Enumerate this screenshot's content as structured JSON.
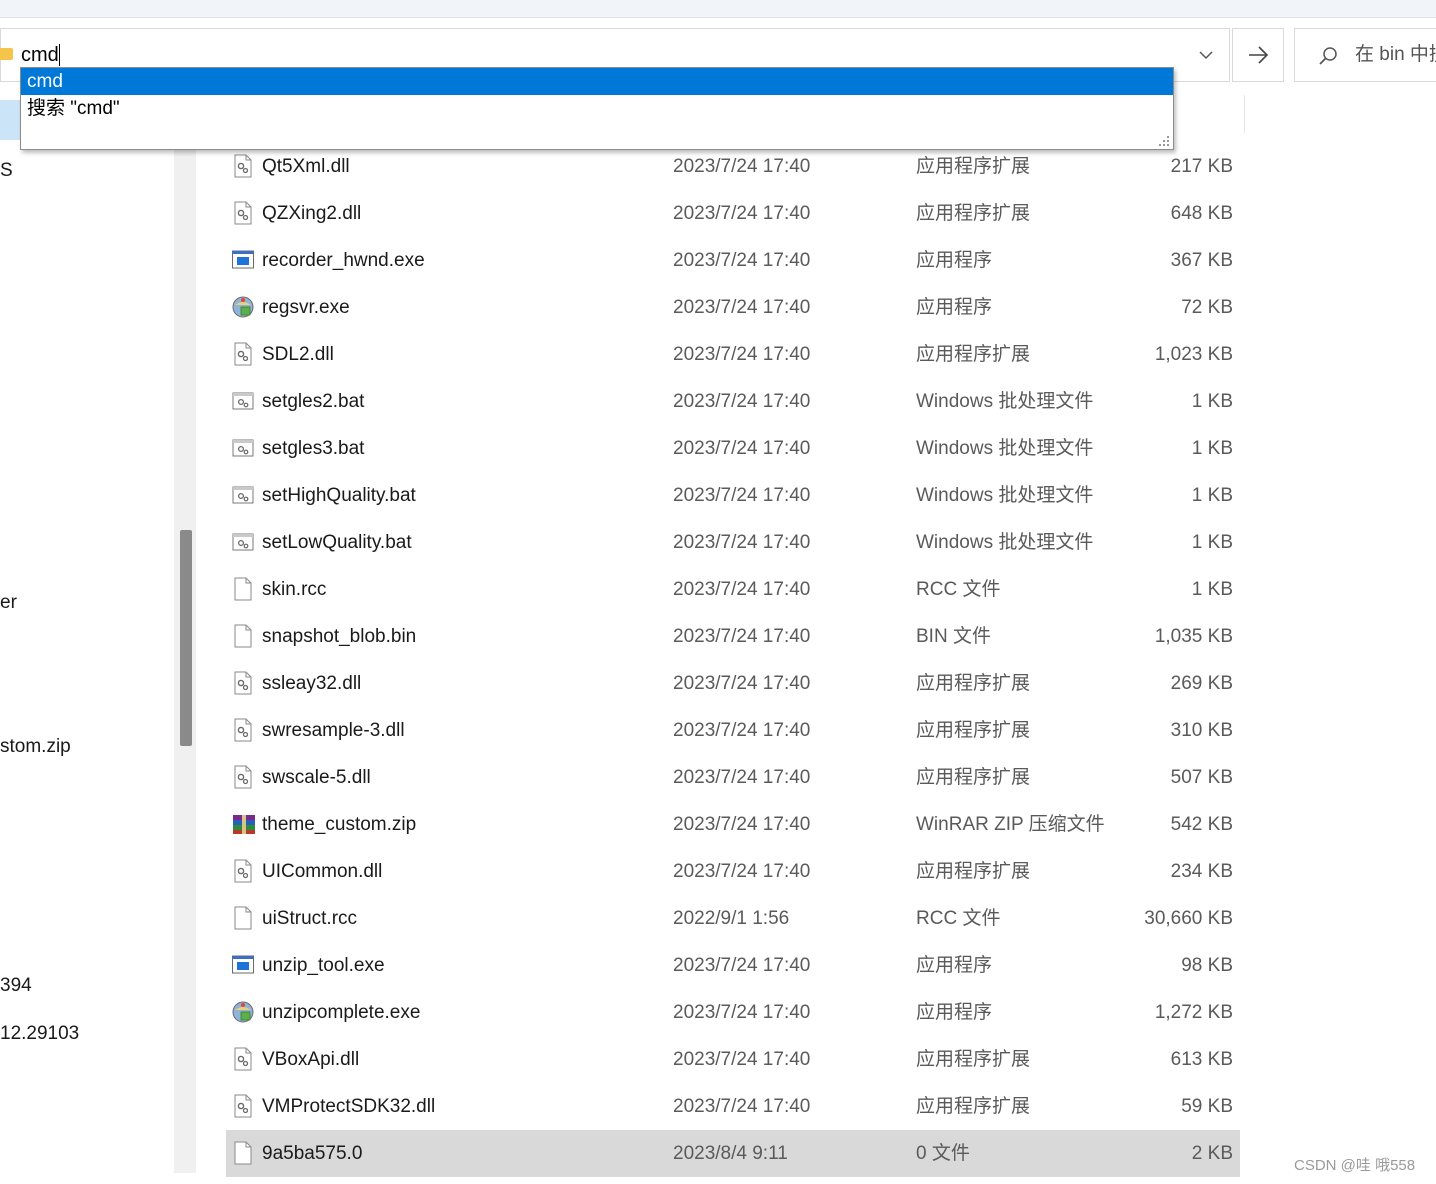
{
  "address_bar": {
    "value": "cmd",
    "dropdown_icon": "chevron-down-icon",
    "go_icon": "arrow-right-icon"
  },
  "autocomplete": {
    "items": [
      "cmd",
      "搜索 \"cmd\""
    ]
  },
  "search": {
    "placeholder": "在 bin 中搜索",
    "icon": "search-icon"
  },
  "sidebar": {
    "items": [
      "S",
      "er",
      "stom.zip",
      "394",
      "12.29103"
    ]
  },
  "files": [
    {
      "name": "Qt5Xml.dll",
      "date": "2023/7/24 17:40",
      "type": "应用程序扩展",
      "size": "217 KB",
      "icon": "dll-icon"
    },
    {
      "name": "QZXing2.dll",
      "date": "2023/7/24 17:40",
      "type": "应用程序扩展",
      "size": "648 KB",
      "icon": "dll-icon"
    },
    {
      "name": "recorder_hwnd.exe",
      "date": "2023/7/24 17:40",
      "type": "应用程序",
      "size": "367 KB",
      "icon": "exe-window-icon"
    },
    {
      "name": "regsvr.exe",
      "date": "2023/7/24 17:40",
      "type": "应用程序",
      "size": "72 KB",
      "icon": "installer-globe-icon"
    },
    {
      "name": "SDL2.dll",
      "date": "2023/7/24 17:40",
      "type": "应用程序扩展",
      "size": "1,023 KB",
      "icon": "dll-icon"
    },
    {
      "name": "setgles2.bat",
      "date": "2023/7/24 17:40",
      "type": "Windows 批处理文件",
      "size": "1 KB",
      "icon": "bat-icon"
    },
    {
      "name": "setgles3.bat",
      "date": "2023/7/24 17:40",
      "type": "Windows 批处理文件",
      "size": "1 KB",
      "icon": "bat-icon"
    },
    {
      "name": "setHighQuality.bat",
      "date": "2023/7/24 17:40",
      "type": "Windows 批处理文件",
      "size": "1 KB",
      "icon": "bat-icon"
    },
    {
      "name": "setLowQuality.bat",
      "date": "2023/7/24 17:40",
      "type": "Windows 批处理文件",
      "size": "1 KB",
      "icon": "bat-icon"
    },
    {
      "name": "skin.rcc",
      "date": "2023/7/24 17:40",
      "type": "RCC 文件",
      "size": "1 KB",
      "icon": "blank-file-icon"
    },
    {
      "name": "snapshot_blob.bin",
      "date": "2023/7/24 17:40",
      "type": "BIN 文件",
      "size": "1,035 KB",
      "icon": "blank-file-icon"
    },
    {
      "name": "ssleay32.dll",
      "date": "2023/7/24 17:40",
      "type": "应用程序扩展",
      "size": "269 KB",
      "icon": "dll-icon"
    },
    {
      "name": "swresample-3.dll",
      "date": "2023/7/24 17:40",
      "type": "应用程序扩展",
      "size": "310 KB",
      "icon": "dll-icon"
    },
    {
      "name": "swscale-5.dll",
      "date": "2023/7/24 17:40",
      "type": "应用程序扩展",
      "size": "507 KB",
      "icon": "dll-icon"
    },
    {
      "name": "theme_custom.zip",
      "date": "2023/7/24 17:40",
      "type": "WinRAR ZIP 压缩文件",
      "size": "542 KB",
      "icon": "winrar-archive-icon"
    },
    {
      "name": "UICommon.dll",
      "date": "2023/7/24 17:40",
      "type": "应用程序扩展",
      "size": "234 KB",
      "icon": "dll-icon"
    },
    {
      "name": "uiStruct.rcc",
      "date": "2022/9/1 1:56",
      "type": "RCC 文件",
      "size": "30,660 KB",
      "icon": "blank-file-icon"
    },
    {
      "name": "unzip_tool.exe",
      "date": "2023/7/24 17:40",
      "type": "应用程序",
      "size": "98 KB",
      "icon": "exe-window-icon"
    },
    {
      "name": "unzipcomplete.exe",
      "date": "2023/7/24 17:40",
      "type": "应用程序",
      "size": "1,272 KB",
      "icon": "installer-globe-icon"
    },
    {
      "name": "VBoxApi.dll",
      "date": "2023/7/24 17:40",
      "type": "应用程序扩展",
      "size": "613 KB",
      "icon": "dll-icon"
    },
    {
      "name": "VMProtectSDK32.dll",
      "date": "2023/7/24 17:40",
      "type": "应用程序扩展",
      "size": "59 KB",
      "icon": "dll-icon"
    },
    {
      "name": "9a5ba575.0",
      "date": "2023/8/4 9:11",
      "type": "0 文件",
      "size": "2 KB",
      "icon": "blank-file-icon",
      "selected": true
    }
  ],
  "watermark": "CSDN @哇 哦558",
  "colors": {
    "selection_blue": "#0078d7",
    "row_selected": "#d9d9d9",
    "meta_text": "#5a5a5a",
    "folder_yellow": "#f4c54a"
  }
}
